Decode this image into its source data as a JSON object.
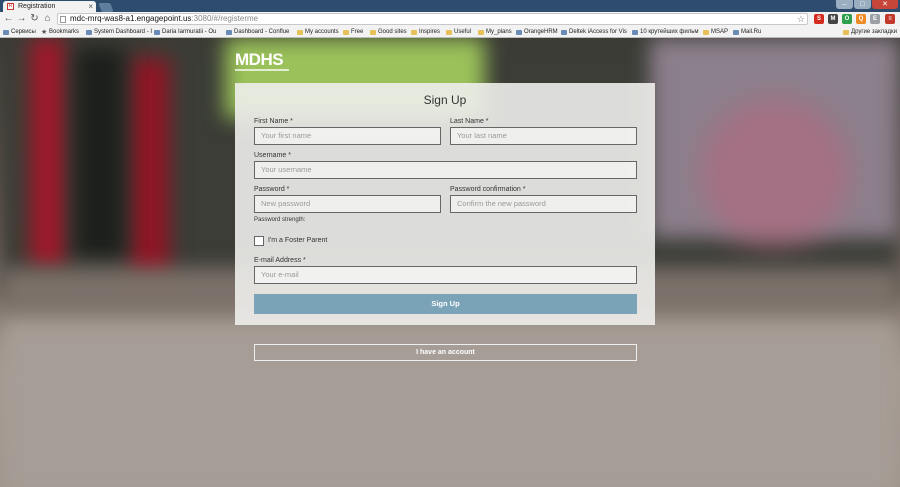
{
  "browser": {
    "tab_title": "Registration",
    "tab_close": "×",
    "url_host": "mdc-mrq-was8-a1.engagepoint.us",
    "url_path": ":3080/#/registerme",
    "window_buttons": {
      "minimize": "–",
      "maximize": "□",
      "close": "✕"
    },
    "extensions": [
      {
        "label": "S",
        "color": "#d52b1e"
      },
      {
        "label": "M",
        "color": "#444"
      },
      {
        "label": "O",
        "color": "#2e9f4b"
      },
      {
        "label": "Q",
        "color": "#f08a24"
      },
      {
        "label": "E",
        "color": "#9aa0a6"
      },
      {
        "label": "≡",
        "color": "#c0392b"
      }
    ],
    "bookmarks": [
      {
        "label": "Сервисы",
        "icon": "apps-icon"
      },
      {
        "label": "Bookmarks",
        "icon": "star-icon"
      },
      {
        "label": "System Dashboard - I",
        "icon": "page-icon"
      },
      {
        "label": "Daria Iarmuratii - Ou",
        "icon": "page-icon"
      },
      {
        "label": "Dashboard - Conflue",
        "icon": "page-icon"
      },
      {
        "label": "My accounts",
        "icon": "folder-icon"
      },
      {
        "label": "Free",
        "icon": "folder-icon"
      },
      {
        "label": "Good sites",
        "icon": "folder-icon"
      },
      {
        "label": "Inspires",
        "icon": "folder-icon"
      },
      {
        "label": "Useful",
        "icon": "folder-icon"
      },
      {
        "label": "My_plans",
        "icon": "folder-icon"
      },
      {
        "label": "OrangeHRM",
        "icon": "page-icon"
      },
      {
        "label": "Deltek iAccess for Vis",
        "icon": "page-icon"
      },
      {
        "label": "10 крутейших фильм",
        "icon": "page-icon"
      },
      {
        "label": "MSAP",
        "icon": "folder-icon"
      },
      {
        "label": "Mail.Ru",
        "icon": "page-icon"
      },
      {
        "label": "Другие закладки",
        "icon": "folder-icon"
      }
    ]
  },
  "page": {
    "logo": "MDHS",
    "title": "Sign Up",
    "first_name_label": "First Name *",
    "first_name_placeholder": "Your first name",
    "last_name_label": "Last Name *",
    "last_name_placeholder": "Your last name",
    "username_label": "Username *",
    "username_placeholder": "Your username",
    "password_label": "Password *",
    "password_placeholder": "New password",
    "password_confirm_label": "Password confirmation *",
    "password_confirm_placeholder": "Confirm the new password",
    "password_strength": "Password strength:",
    "foster_label": "I'm a Foster Parent",
    "email_label": "E-mail Address *",
    "email_placeholder": "Your e-mail",
    "signup_button": "Sign Up",
    "account_button": "I have an account"
  }
}
